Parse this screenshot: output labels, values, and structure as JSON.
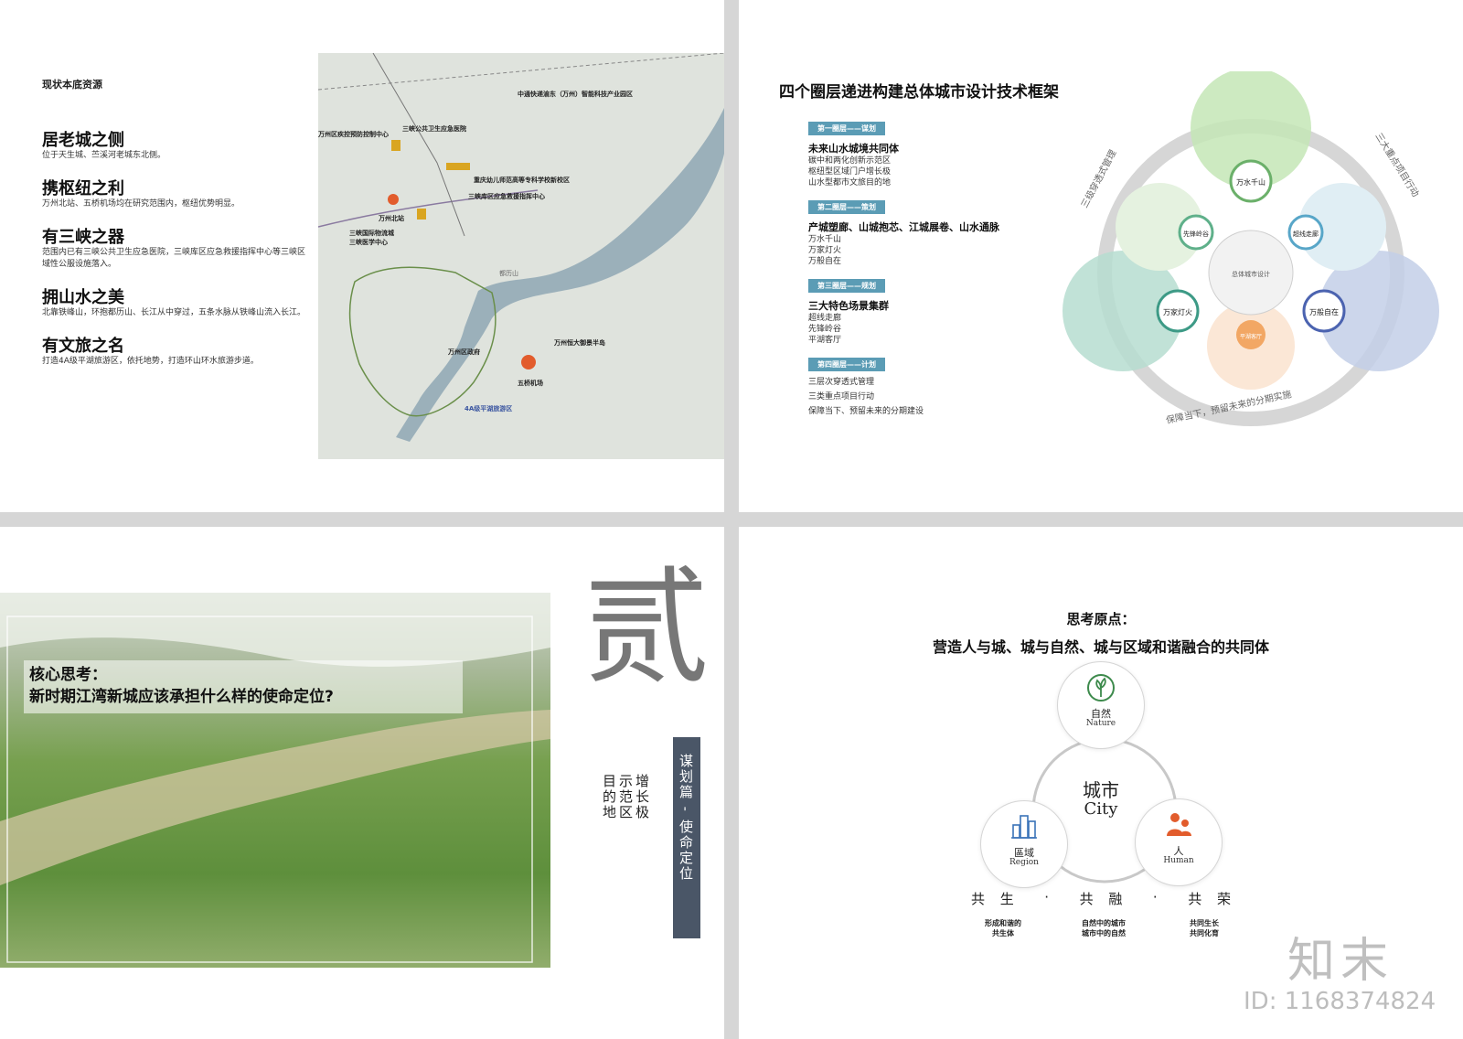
{
  "slide1": {
    "header": "现状本底资源",
    "items": [
      {
        "title": "居老城之侧",
        "text": "位于天生城、苎溪河老城东北侧。"
      },
      {
        "title": "携枢纽之利",
        "text": "万州北站、五桥机场均在研究范围内，枢纽优势明显。"
      },
      {
        "title": "有三峡之器",
        "text": "范围内已有三峡公共卫生应急医院，三峡库区应急救援指挥中心等三峡区域性公服设施落入。"
      },
      {
        "title": "拥山水之美",
        "text": "北靠铁峰山，环抱都历山、长江从中穿过，五条水脉从铁峰山流入长江。"
      },
      {
        "title": "有文旅之名",
        "text": "打造4A级平湖旅游区，依托地势，打造环山环水旅游步道。"
      }
    ],
    "map_labels": [
      "中通快递渝东（万州）智能科技产业园区",
      "万州区疾控预防控制中心",
      "三峡公共卫生应急医院",
      "重庆幼儿师范高等专科学校新校区",
      "三峡库区应急救援指挥中心",
      "万州北站",
      "三峡国际物流城",
      "三峡医学中心",
      "万州区政府",
      "五桥机场",
      "万州恒大御景半岛",
      "4A级平湖旅游区",
      "都历山"
    ]
  },
  "slide2": {
    "title": "四个圈层递进构建总体城市设计技术框架",
    "layers": [
      {
        "tag": "第一圈层——谋划",
        "subtitle": "未来山水城境共同体",
        "lines": [
          "碳中和两化创新示范区",
          "枢纽型区域门户增长极",
          "山水型都市文旅目的地"
        ]
      },
      {
        "tag": "第二圈层——策划",
        "subtitle": "产城塑廊、山城抱芯、江城展卷、山水通脉",
        "lines": [
          "万水千山",
          "万家灯火",
          "万般自在"
        ]
      },
      {
        "tag": "第三圈层——规划",
        "subtitle": "三大特色场景集群",
        "lines": [
          "超线走廊",
          "先锋岭谷",
          "平湖客厅"
        ]
      },
      {
        "tag": "第四圈层——计划",
        "subtitle": "",
        "lines": [
          "三层次穿透式管理",
          "三类重点项目行动",
          "保障当下、预留未来的分期建设"
        ]
      }
    ],
    "diagram": {
      "ring_left": "三级穿透式管理",
      "ring_right": "三大重点项目行动",
      "ring_bottom": "保障当下，预留未来的分期实施",
      "center": "总体城市设计",
      "nodes": [
        "万水千山",
        "先锋岭谷",
        "超线走廊",
        "万家灯火",
        "平湖客厅",
        "万般自在"
      ]
    }
  },
  "slide3": {
    "question_title": "核心思考：",
    "question": "新时期江湾新城应该承担什么样的使命定位?",
    "big_char": "贰",
    "vertical_left": [
      "增长极",
      "示范区",
      "目的地"
    ],
    "vertical_banner": "谋划篇 - 使命定位"
  },
  "slide4": {
    "title1": "思考原点：",
    "title2": "营造人与城、城与自然、城与区域和谐融合的共同体",
    "nodes": [
      {
        "cn": "自然",
        "en": "Nature"
      },
      {
        "cn": "區域",
        "en": "Region"
      },
      {
        "cn": "人",
        "en": "Human"
      }
    ],
    "center_cn": "城市",
    "center_en": "City",
    "slogan": [
      "共 生",
      "·",
      "共 融",
      "·",
      "共 荣"
    ],
    "captions": [
      [
        "形成和谐的",
        "共生体"
      ],
      [
        "自然中的城市",
        "城市中的自然"
      ],
      [
        "共同生长",
        "共同化育"
      ]
    ],
    "colors": {
      "accent_green": "#3d8a4c",
      "accent_orange": "#e25c2c",
      "accent_blue": "#3a73b8"
    }
  },
  "watermark": {
    "logo": "知末",
    "id": "ID: 1168374824"
  }
}
